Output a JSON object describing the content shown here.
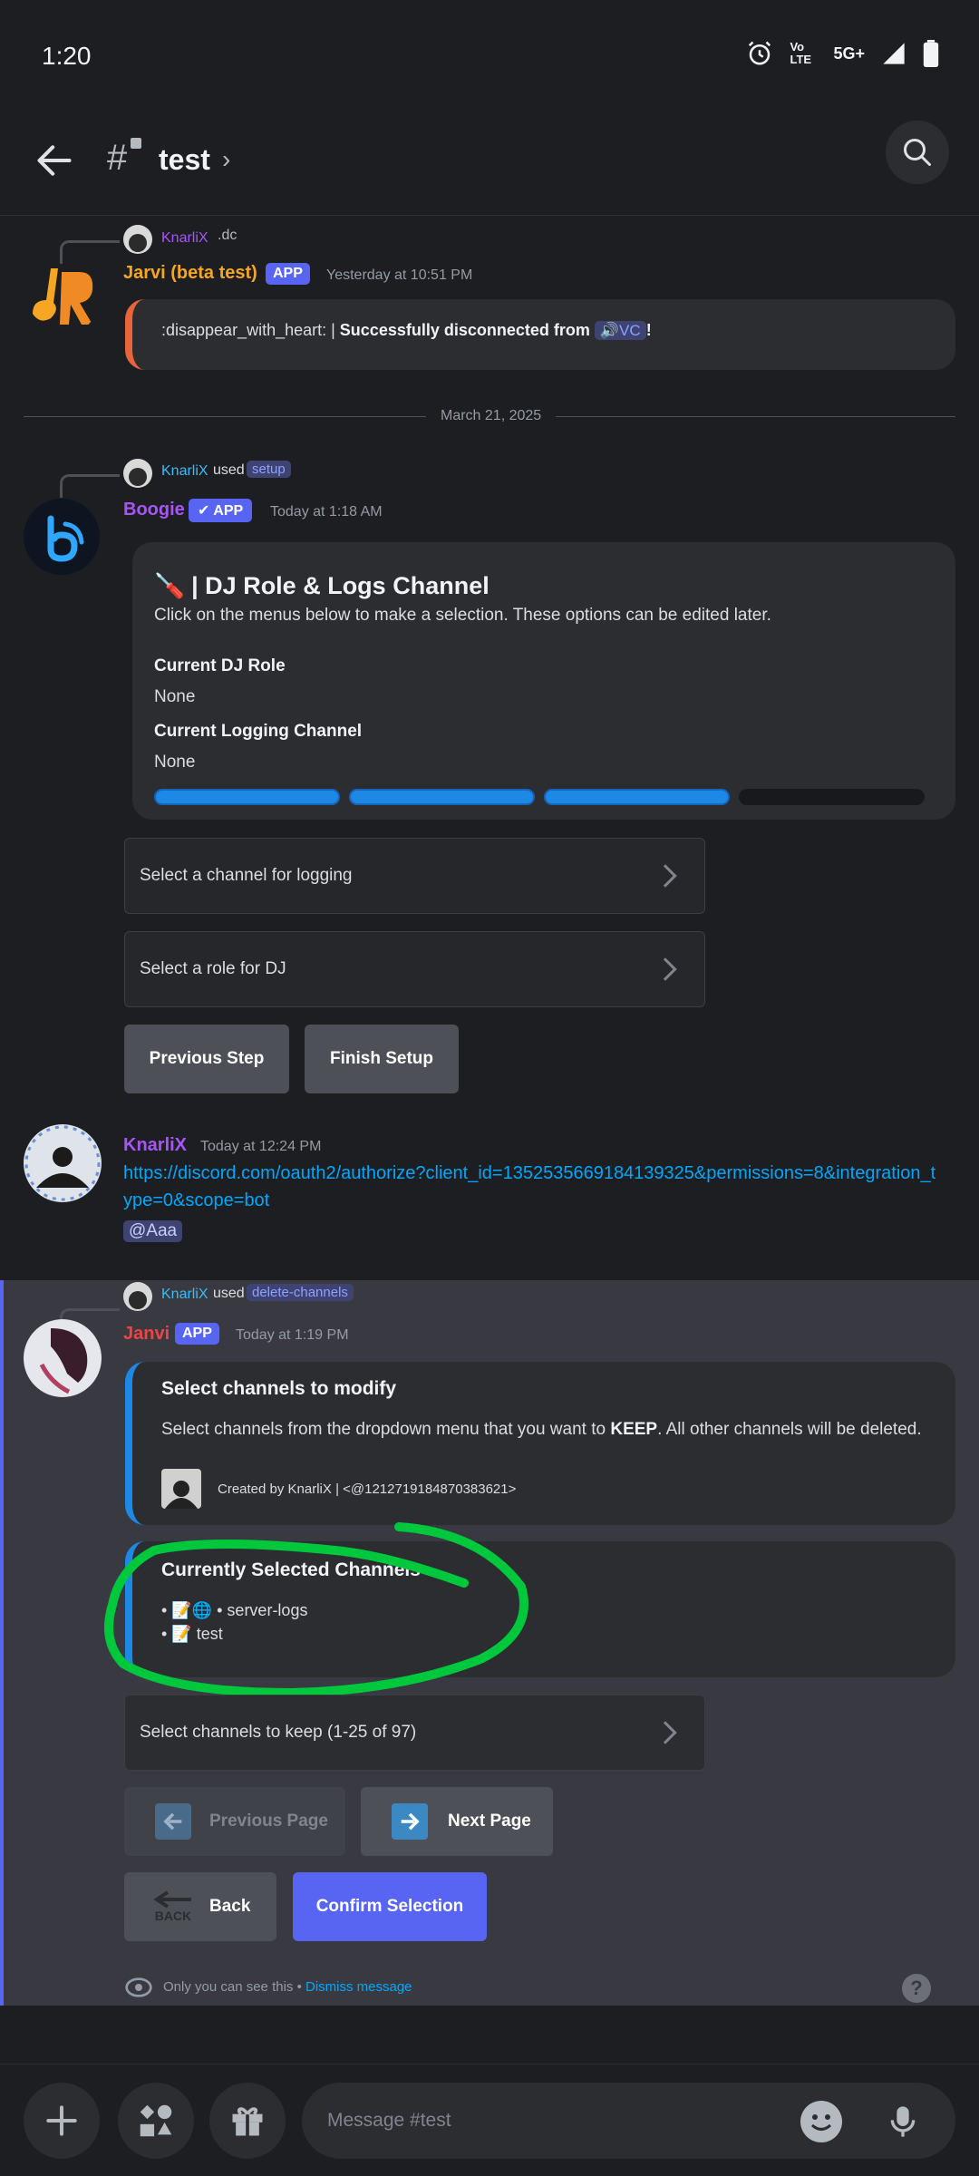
{
  "status": {
    "time": "1:20",
    "network": "5G+",
    "volte": "Vo LTE"
  },
  "header": {
    "channel": "test",
    "hash": "#"
  },
  "msg1": {
    "reply_user": "KnarliX",
    "reply_tag": ".dc",
    "username": "Jarvi (beta test)",
    "badge": "APP",
    "timestamp": "Yesterday at 10:51 PM",
    "text_prefix": ":disappear_with_heart: | ",
    "text_bold": "Successfully disconnected from ",
    "vc_label": "🔊VC",
    "text_end": "!"
  },
  "date_divider": "March 21, 2025",
  "msg2": {
    "reply_user": "KnarliX",
    "used": "used",
    "command": "setup",
    "username": "Boogie",
    "badge": "✔ APP",
    "timestamp": "Today at 1:18 AM",
    "embed_title": "🪛 | DJ Role & Logs Channel",
    "embed_desc": "Click on the menus below to make a selection. These options can be edited later.",
    "field1_name": "Current DJ Role",
    "field1_value": "None",
    "field2_name": "Current Logging Channel",
    "field2_value": "None",
    "progress": [
      1,
      1,
      1,
      0
    ],
    "select1": "Select a channel for logging",
    "select2": "Select a role for DJ",
    "btn_prev": "Previous Step",
    "btn_finish": "Finish Setup"
  },
  "msg3": {
    "username": "KnarliX",
    "timestamp": "Today at 12:24 PM",
    "link": "https://discord.com/oauth2/authorize?client_id=1352535669184139325&permissions=8&integration_type=0&scope=bot",
    "mention": "@Aaa"
  },
  "msg4": {
    "reply_user": "KnarliX",
    "used": "used",
    "command": "delete-channels",
    "username": "Janvi",
    "badge": "APP",
    "timestamp": "Today at 1:19 PM",
    "embed1_title": "Select channels to modify",
    "embed1_desc_a": "Select channels from the dropdown menu that you want to ",
    "embed1_desc_bold": "KEEP",
    "embed1_desc_b": ". All other channels will be deleted.",
    "embed1_footer": "Created by KnarliX | <@1212719184870383621>",
    "embed2_title": "Currently Selected Channels",
    "embed2_line1": "• 📝🌐 • server-logs",
    "embed2_line2": "• 📝 test",
    "select": "Select channels to keep (1-25 of 97)",
    "btn_prev_page": "Previous Page",
    "btn_next_page": "Next Page",
    "btn_back": "Back",
    "back_icon_text": "BACK",
    "btn_confirm": "Confirm Selection",
    "ephemeral_note": "Only you can see this • ",
    "dismiss": "Dismiss message",
    "help": "?"
  },
  "composer": {
    "placeholder": "Message #test"
  },
  "colors": {
    "accent": "#5865f2",
    "link": "#00a8fc",
    "highlight": "#00c83c"
  }
}
